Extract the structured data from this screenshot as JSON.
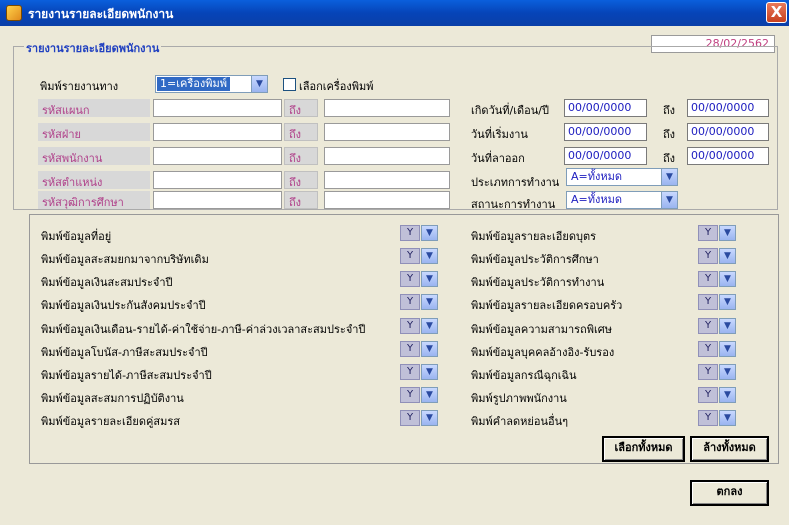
{
  "window": {
    "title": "รายงานรายละเอียดพนักงาน",
    "close_label": "X"
  },
  "date": "28/02/2562",
  "group1": {
    "legend": "รายงานรายละเอียดพนักงาน",
    "print_via_label": "พิมพ์รายงานทาง",
    "print_via_value": "1=เครื่องพิมพ์",
    "choose_printer_label": "เลือกเครื่องพิมพ์",
    "to_label": "ถึง",
    "rows": [
      {
        "label": "รหัสแผนก"
      },
      {
        "label": "รหัสฝ่าย"
      },
      {
        "label": "รหัสพนักงาน"
      },
      {
        "label": "รหัสตำแหน่ง"
      },
      {
        "label": "รหัสวุฒิการศึกษา"
      }
    ],
    "birth_label": "เกิดวันที่/เดือน/ปี",
    "start_label": "วันที่เริ่มงาน",
    "leave_label": "วันที่ลาออก",
    "date_from": "00/00/0000",
    "date_to": "00/00/0000",
    "work_type_label": "ประเภทการทำงาน",
    "work_type_value": "A=ทั้งหมด",
    "work_status_label": "สถานะการทำงาน",
    "work_status_value": "A=ทั้งหมด"
  },
  "group2": {
    "y_value": "Y",
    "left_items": [
      "พิมพ์ข้อมูลที่อยู่",
      "พิมพ์ข้อมูลสะสมยกมาจากบริษัทเดิม",
      "พิมพ์ข้อมูลเงินสะสมประจำปี",
      "พิมพ์ข้อมูลเงินประกันสังคมประจำปี",
      "พิมพ์ข้อมูลเงินเดือน-รายได้-ค่าใช้จ่าย-ภาษี-ค่าล่วงเวลาสะสมประจำปี",
      "พิมพ์ข้อมูลโบนัส-ภาษีสะสมประจำปี",
      "พิมพ์ข้อมูลรายได้-ภาษีสะสมประจำปี",
      "พิมพ์ข้อมูลสะสมการปฏิบัติงาน",
      "พิมพ์ข้อมูลรายละเอียดคู่สมรส"
    ],
    "right_items": [
      "พิมพ์ข้อมูลรายละเอียดบุตร",
      "พิมพ์ข้อมูลประวัติการศึกษา",
      "พิมพ์ข้อมูลประวัติการทำงาน",
      "พิมพ์ข้อมูลรายละเอียดครอบครัว",
      "พิมพ์ข้อมูลความสามารถพิเศษ",
      "พิมพ์ข้อมูลบุคคลอ้างอิง-รับรอง",
      "พิมพ์ข้อมูลกรณีฉุกเฉิน",
      "พิมพ์รูปภาพพนักงาน",
      "พิมพ์คำลดหย่อนอื่นๆ"
    ],
    "select_all": "เลือกทั้งหมด",
    "clear_all": "ล้างทั้งหมด"
  },
  "ok_label": "ตกลง"
}
